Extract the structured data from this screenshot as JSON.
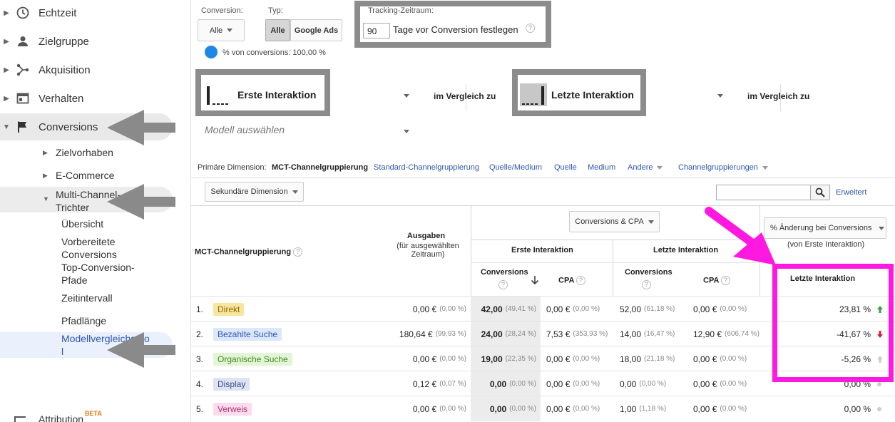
{
  "sidebar": {
    "items": [
      {
        "label": "Echtzeit",
        "icon": "clock-icon"
      },
      {
        "label": "Zielgruppe",
        "icon": "person-icon"
      },
      {
        "label": "Akquisition",
        "icon": "acquisition-icon"
      },
      {
        "label": "Verhalten",
        "icon": "behavior-icon"
      },
      {
        "label": "Conversions",
        "icon": "flag-icon"
      }
    ],
    "sub_items": [
      "Zielvorhaben",
      "E-Commerce",
      "Multi-Channel-Trichter"
    ],
    "leaf_items": [
      "Übersicht",
      "Vorbereitete Conversions",
      "Top-Conversion-Pfade",
      "Zeitintervall",
      "Pfadlänge",
      "Modellvergleichstool"
    ],
    "attribution": "Attribution",
    "attribution_badge": "BETA"
  },
  "controls": {
    "conversion_label": "Conversion:",
    "conversion_value": "Alle",
    "type_label": "Typ:",
    "type_all": "Alle",
    "type_ads": "Google Ads",
    "tracking_label": "Tracking-Zeitraum:",
    "tracking_value": "90",
    "tracking_suffix": "Tage vor Conversion festlegen",
    "share_text": "% von conversions: 100,00 %",
    "share_color": "#1e88e5"
  },
  "models": {
    "first": "Erste Interaktion",
    "compare1": "im Vergleich zu",
    "last": "Letzte Interaktion",
    "compare2": "im Vergleich zu",
    "select_placeholder": "Modell auswählen"
  },
  "dimensions": {
    "primary_label": "Primäre Dimension:",
    "active": "MCT-Channelgruppierung",
    "links": [
      "Standard-Channelgruppierung",
      "Quelle/Medium",
      "Quelle",
      "Medium",
      "Andere",
      "Channelgruppierungen"
    ],
    "secondary": "Sekundäre Dimension",
    "advanced": "Erweitert"
  },
  "table": {
    "col_dimension": "MCT-Channelgruppierung",
    "col_spend": "Ausgaben",
    "col_spend_sub": "(für ausgewählten Zeitraum)",
    "metric_select": "Conversions & CPA",
    "group_first": "Erste Interaktion",
    "group_last": "Letzte Interaktion",
    "col_conversions": "Conversions",
    "col_cpa": "CPA",
    "change_select": "% Änderung bei Conversions",
    "change_sub": "(von Erste Interaktion)",
    "change_col": "Letzte Interaktion",
    "rows": [
      {
        "idx": "1.",
        "name": "Direkt",
        "chip": "#f8e6a0",
        "chip_text": "#8a6d00",
        "spend": "0,00 €",
        "spend_pct": "(0,00 %)",
        "fc": "42,00",
        "fc_pct": "(49,41 %)",
        "fcpa": "0,00 €",
        "fcpa_pct": "(0,00 %)",
        "lc": "52,00",
        "lc_pct": "(61,18 %)",
        "lcpa": "0,00 €",
        "lcpa_pct": "(0,00 %)",
        "change": "23,81 %",
        "trend": "up"
      },
      {
        "idx": "2.",
        "name": "Bezahlte Suche",
        "chip": "#dbe7fb",
        "chip_text": "#2f57b1",
        "spend": "180,64 €",
        "spend_pct": "(99,93 %)",
        "fc": "24,00",
        "fc_pct": "(28,24 %)",
        "fcpa": "7,53 €",
        "fcpa_pct": "(353,93 %)",
        "lc": "14,00",
        "lc_pct": "(16,47 %)",
        "lcpa": "12,90 €",
        "lcpa_pct": "(606,74 %)",
        "change": "-41,67 %",
        "trend": "down"
      },
      {
        "idx": "3.",
        "name": "Organische Suche",
        "chip": "#e3f4d7",
        "chip_text": "#3f8a1f",
        "spend": "0,00 €",
        "spend_pct": "(0,00 %)",
        "fc": "19,00",
        "fc_pct": "(22,35 %)",
        "fcpa": "0,00 €",
        "fcpa_pct": "(0,00 %)",
        "lc": "18,00",
        "lc_pct": "(21,18 %)",
        "lcpa": "0,00 €",
        "lcpa_pct": "(0,00 %)",
        "change": "-5,26 %",
        "trend": "flat"
      },
      {
        "idx": "4.",
        "name": "Display",
        "chip": "#dde3f3",
        "chip_text": "#3a4a8c",
        "spend": "0,12 €",
        "spend_pct": "(0,07 %)",
        "fc": "0,00",
        "fc_pct": "(0,00 %)",
        "fcpa": "0,00 €",
        "fcpa_pct": "(0,00 %)",
        "lc": "0,00",
        "lc_pct": "(0,00 %)",
        "lcpa": "0,00 €",
        "lcpa_pct": "(0,00 %)",
        "change": "0,00 %",
        "trend": "none"
      },
      {
        "idx": "5.",
        "name": "Verweis",
        "chip": "#fadcec",
        "chip_text": "#b0306f",
        "spend": "0,00 €",
        "spend_pct": "(0,00 %)",
        "fc": "0,00",
        "fc_pct": "(0,00 %)",
        "fcpa": "0,00 €",
        "fcpa_pct": "(0,00 %)",
        "lc": "1,00",
        "lc_pct": "(1,18 %)",
        "lcpa": "0,00 €",
        "lcpa_pct": "(0,00 %)",
        "change": "0,00 %",
        "trend": "none"
      }
    ]
  },
  "annotation_color": "#ff19e0",
  "arrow_color": "#8a8a8a"
}
